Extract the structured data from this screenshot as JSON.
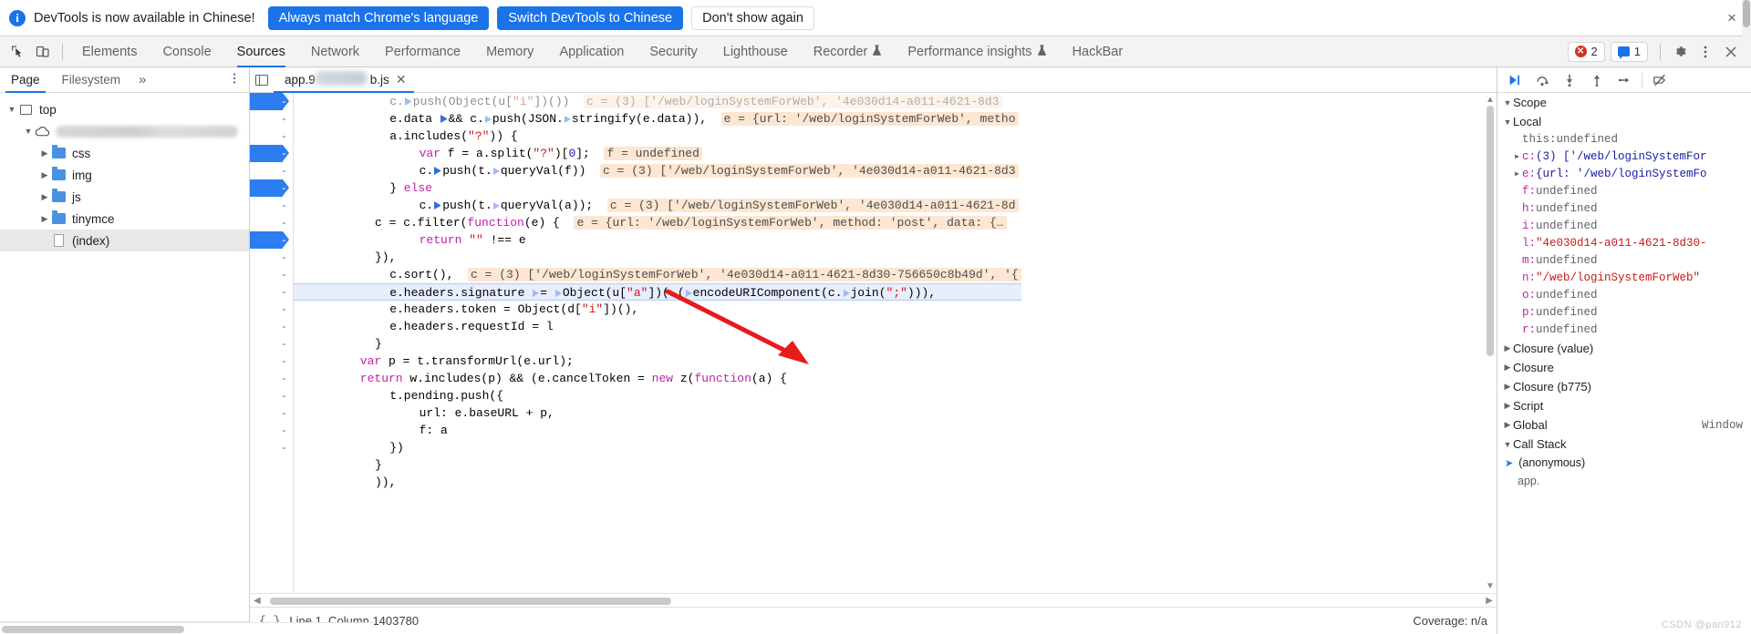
{
  "banner": {
    "icon": "info-icon",
    "message": "DevTools is now available in Chinese!",
    "primary_btn": "Always match Chrome's language",
    "secondary_btn": "Switch DevTools to Chinese",
    "dismiss_btn": "Don't show again",
    "close": "×"
  },
  "toolbar": {
    "inspect_icon": "inspect-cursor-icon",
    "device_icon": "device-toolbar-icon",
    "tabs": [
      {
        "label": "Elements",
        "active": false,
        "flask": false
      },
      {
        "label": "Console",
        "active": false,
        "flask": false
      },
      {
        "label": "Sources",
        "active": true,
        "flask": false
      },
      {
        "label": "Network",
        "active": false,
        "flask": false
      },
      {
        "label": "Performance",
        "active": false,
        "flask": false
      },
      {
        "label": "Memory",
        "active": false,
        "flask": false
      },
      {
        "label": "Application",
        "active": false,
        "flask": false
      },
      {
        "label": "Security",
        "active": false,
        "flask": false
      },
      {
        "label": "Lighthouse",
        "active": false,
        "flask": false
      },
      {
        "label": "Recorder",
        "active": false,
        "flask": true
      },
      {
        "label": "Performance insights",
        "active": false,
        "flask": true
      },
      {
        "label": "HackBar",
        "active": false,
        "flask": false
      }
    ],
    "error_count": "2",
    "message_count": "1",
    "settings_icon": "gear-icon",
    "more_icon": "kebab-menu-icon",
    "close_icon": "close-icon"
  },
  "navigator": {
    "tabs": [
      {
        "label": "Page",
        "active": true
      },
      {
        "label": "Filesystem",
        "active": false
      }
    ],
    "more": "»",
    "menu_icon": "kebab-menu-icon",
    "tree": [
      {
        "label": "top",
        "type": "frame",
        "depth": 0,
        "expanded": true,
        "selected": false
      },
      {
        "label": "",
        "type": "domain",
        "depth": 1,
        "expanded": true,
        "selected": false,
        "redacted": true
      },
      {
        "label": "css",
        "type": "folder",
        "depth": 2,
        "expanded": false,
        "selected": false
      },
      {
        "label": "img",
        "type": "folder",
        "depth": 2,
        "expanded": false,
        "selected": false
      },
      {
        "label": "js",
        "type": "folder",
        "depth": 2,
        "expanded": false,
        "selected": false
      },
      {
        "label": "tinymce",
        "type": "folder",
        "depth": 2,
        "expanded": false,
        "selected": false
      },
      {
        "label": "(index)",
        "type": "file",
        "depth": 2,
        "expanded": false,
        "selected": true
      }
    ]
  },
  "editor": {
    "panel_toggle_icon": "show-navigator-icon",
    "file_tab": {
      "name_prefix": "app.9",
      "name_suffix": "b.js",
      "close": "✕",
      "redacted": true
    },
    "status": {
      "braces_icon": "pretty-print-icon",
      "position": "Line 1, Column 1403780",
      "coverage": "Coverage: n/a"
    },
    "gutter_marks": [
      {
        "covered": true,
        "dash": "-"
      },
      {
        "covered": false,
        "dash": "-"
      },
      {
        "covered": false,
        "dash": "-"
      },
      {
        "covered": true,
        "dash": "-"
      },
      {
        "covered": false,
        "dash": "-"
      },
      {
        "covered": true,
        "dash": "-"
      },
      {
        "covered": false,
        "dash": "-"
      },
      {
        "covered": false,
        "dash": "-"
      },
      {
        "covered": true,
        "dash": "-"
      },
      {
        "covered": false,
        "dash": "-"
      },
      {
        "covered": false,
        "dash": "-"
      },
      {
        "covered": false,
        "dash": "-"
      },
      {
        "covered": false,
        "dash": "-"
      },
      {
        "covered": false,
        "dash": "-"
      },
      {
        "covered": false,
        "dash": "-"
      },
      {
        "covered": false,
        "dash": "-"
      },
      {
        "covered": false,
        "dash": "-"
      },
      {
        "covered": false,
        "dash": "-"
      },
      {
        "covered": false,
        "dash": "-"
      },
      {
        "covered": false,
        "dash": "-"
      },
      {
        "covered": false,
        "dash": "-"
      }
    ],
    "code_lines": [
      {
        "indent": 12,
        "clipped": true,
        "tokens": [
          {
            "t": "c.",
            "c": ""
          },
          {
            "t": "▸",
            "c": "tri-f"
          },
          {
            "t": "push(Object(u[",
            "c": ""
          },
          {
            "t": "\"i\"",
            "c": "str"
          },
          {
            "t": "])())",
            "c": ""
          }
        ],
        "hint": "c = (3) ['/web/loginSystemForWeb', '4e030d14-a011-4621-8d3"
      },
      {
        "indent": 12,
        "tokens": [
          {
            "t": "e.data ",
            "c": ""
          },
          {
            "t": "▸",
            "c": "tri-f"
          },
          {
            "t": "&& c.",
            "c": ""
          },
          {
            "t": "▸",
            "c": "tri-o"
          },
          {
            "t": "push(JSON.",
            "c": ""
          },
          {
            "t": "▸",
            "c": "tri-o"
          },
          {
            "t": "stringify(e.data)),",
            "c": ""
          }
        ],
        "hint": "e = {url: '/web/loginSystemForWeb', metho"
      },
      {
        "indent": 12,
        "tokens": [
          {
            "t": "a.includes(",
            "c": ""
          },
          {
            "t": "\"?\"",
            "c": "str"
          },
          {
            "t": ")) {",
            "c": ""
          }
        ],
        "hint": ""
      },
      {
        "indent": 16,
        "tokens": [
          {
            "t": "var",
            "c": "kw"
          },
          {
            "t": " f = a.split(",
            "c": ""
          },
          {
            "t": "\"?\"",
            "c": "str"
          },
          {
            "t": ")[",
            "c": ""
          },
          {
            "t": "0",
            "c": "num-lit"
          },
          {
            "t": "];",
            "c": ""
          }
        ],
        "hint": "f = undefined"
      },
      {
        "indent": 16,
        "tokens": [
          {
            "t": "c.",
            "c": ""
          },
          {
            "t": "▸",
            "c": "tri-f"
          },
          {
            "t": "push(t.",
            "c": ""
          },
          {
            "t": "▸",
            "c": "tri-o"
          },
          {
            "t": "queryVal(f))",
            "c": ""
          }
        ],
        "hint": "c = (3) ['/web/loginSystemForWeb', '4e030d14-a011-4621-8d3"
      },
      {
        "indent": 12,
        "tokens": [
          {
            "t": "} ",
            "c": ""
          },
          {
            "t": "else",
            "c": "kw"
          }
        ],
        "hint": ""
      },
      {
        "indent": 16,
        "tokens": [
          {
            "t": "c.",
            "c": ""
          },
          {
            "t": "▸",
            "c": "tri-f"
          },
          {
            "t": "push(t.",
            "c": ""
          },
          {
            "t": "▸",
            "c": "tri-o"
          },
          {
            "t": "queryVal(a));",
            "c": ""
          }
        ],
        "hint": "c = (3) ['/web/loginSystemForWeb', '4e030d14-a011-4621-8d"
      },
      {
        "indent": 10,
        "tokens": [
          {
            "t": "c = c.filter(",
            "c": ""
          },
          {
            "t": "function",
            "c": "fn"
          },
          {
            "t": "(e) {",
            "c": ""
          }
        ],
        "hint": "e = {url: '/web/loginSystemForWeb', method: 'post', data: {…"
      },
      {
        "indent": 16,
        "tokens": [
          {
            "t": "return",
            "c": "kw"
          },
          {
            "t": " ",
            "c": ""
          },
          {
            "t": "\"\"",
            "c": "str"
          },
          {
            "t": " !== e",
            "c": ""
          }
        ],
        "hint": ""
      },
      {
        "indent": 10,
        "tokens": [
          {
            "t": "}),",
            "c": ""
          }
        ],
        "hint": ""
      },
      {
        "indent": 12,
        "tokens": [
          {
            "t": "c.sort(),",
            "c": ""
          }
        ],
        "hint": "c = (3) ['/web/loginSystemForWeb', '4e030d14-a011-4621-8d30-756650c8b49d', '{"
      },
      {
        "indent": 12,
        "highlighted": true,
        "tokens": [
          {
            "t": "e.headers.signature ",
            "c": ""
          },
          {
            "t": "▸",
            "c": "tri-o"
          },
          {
            "t": "= ",
            "c": ""
          },
          {
            "t": "▸",
            "c": "tri-o"
          },
          {
            "t": "Object(u[",
            "c": ""
          },
          {
            "t": "\"a\"",
            "c": "str"
          },
          {
            "t": "])(",
            "c": ""
          },
          {
            "t": "▸",
            "c": "tri-o"
          },
          {
            "t": "(",
            "c": ""
          },
          {
            "t": "▸",
            "c": "tri-o"
          },
          {
            "t": "encodeURIComponent(c.",
            "c": ""
          },
          {
            "t": "▸",
            "c": "tri-o"
          },
          {
            "t": "join(",
            "c": ""
          },
          {
            "t": "\";\"",
            "c": "str"
          },
          {
            "t": "))),",
            "c": ""
          }
        ],
        "hint": ""
      },
      {
        "indent": 12,
        "tokens": [
          {
            "t": "e.headers.token = Object(d[",
            "c": ""
          },
          {
            "t": "\"i\"",
            "c": "str"
          },
          {
            "t": "])(),",
            "c": ""
          }
        ],
        "hint": ""
      },
      {
        "indent": 12,
        "tokens": [
          {
            "t": "e.headers.requestId = l",
            "c": ""
          }
        ],
        "hint": ""
      },
      {
        "indent": 10,
        "tokens": [
          {
            "t": "}",
            "c": ""
          }
        ],
        "hint": ""
      },
      {
        "indent": 8,
        "tokens": [
          {
            "t": "var",
            "c": "kw"
          },
          {
            "t": " p = t.transformUrl(e.url);",
            "c": ""
          }
        ],
        "hint": ""
      },
      {
        "indent": 8,
        "tokens": [
          {
            "t": "return",
            "c": "kw"
          },
          {
            "t": " w.includes(p) && (e.cancelToken = ",
            "c": ""
          },
          {
            "t": "new",
            "c": "kw"
          },
          {
            "t": " z(",
            "c": ""
          },
          {
            "t": "function",
            "c": "fn"
          },
          {
            "t": "(a) {",
            "c": ""
          }
        ],
        "hint": ""
      },
      {
        "indent": 12,
        "tokens": [
          {
            "t": "t.pending.push({",
            "c": ""
          }
        ],
        "hint": ""
      },
      {
        "indent": 16,
        "tokens": [
          {
            "t": "url: e.baseURL + p,",
            "c": ""
          }
        ],
        "hint": ""
      },
      {
        "indent": 16,
        "tokens": [
          {
            "t": "f: a",
            "c": ""
          }
        ],
        "hint": ""
      },
      {
        "indent": 12,
        "tokens": [
          {
            "t": "})",
            "c": ""
          }
        ],
        "hint": ""
      },
      {
        "indent": 10,
        "tokens": [
          {
            "t": "}",
            "c": ""
          }
        ],
        "hint": ""
      },
      {
        "indent": 10,
        "tokens": [
          {
            "t": ")),",
            "c": ""
          }
        ],
        "hint": ""
      }
    ]
  },
  "debugger": {
    "controls": [
      {
        "name": "resume-button",
        "glyph": "▶❘"
      },
      {
        "name": "step-over-button",
        "glyph": "↷"
      },
      {
        "name": "step-into-button",
        "glyph": "↓"
      },
      {
        "name": "step-out-button",
        "glyph": "↑"
      },
      {
        "name": "step-button",
        "glyph": "⇾"
      },
      {
        "name": "deactivate-breakpoints-button",
        "glyph": "⊘"
      }
    ],
    "scope_section": "Scope",
    "local_section": "Local",
    "locals": [
      {
        "name": "this",
        "value": "undefined",
        "kind": "undef",
        "expandable": false
      },
      {
        "name": "c",
        "value": "(3) ['/web/loginSystemFor",
        "kind": "obj",
        "expandable": true
      },
      {
        "name": "e",
        "value": "{url: '/web/loginSystemFo",
        "kind": "obj",
        "expandable": true
      },
      {
        "name": "f",
        "value": "undefined",
        "kind": "undef",
        "expandable": false
      },
      {
        "name": "h",
        "value": "undefined",
        "kind": "undef",
        "expandable": false
      },
      {
        "name": "i",
        "value": "undefined",
        "kind": "undef",
        "expandable": false
      },
      {
        "name": "l",
        "value": "\"4e030d14-a011-4621-8d30-",
        "kind": "str",
        "expandable": false
      },
      {
        "name": "m",
        "value": "undefined",
        "kind": "undef",
        "expandable": false
      },
      {
        "name": "n",
        "value": "\"/web/loginSystemForWeb\"",
        "kind": "str",
        "expandable": false
      },
      {
        "name": "o",
        "value": "undefined",
        "kind": "undef",
        "expandable": false
      },
      {
        "name": "p",
        "value": "undefined",
        "kind": "undef",
        "expandable": false
      },
      {
        "name": "r",
        "value": "undefined",
        "kind": "undef",
        "expandable": false
      }
    ],
    "scopes": [
      {
        "label": "Closure (value)",
        "right": ""
      },
      {
        "label": "Closure",
        "right": ""
      },
      {
        "label": "Closure (b775)",
        "right": ""
      },
      {
        "label": "Script",
        "right": ""
      },
      {
        "label": "Global",
        "right": "Window"
      }
    ],
    "call_stack_section": "Call Stack",
    "call_stack": [
      {
        "label": "(anonymous)",
        "file": "app."
      }
    ]
  },
  "watermark": "CSDN @pan912"
}
